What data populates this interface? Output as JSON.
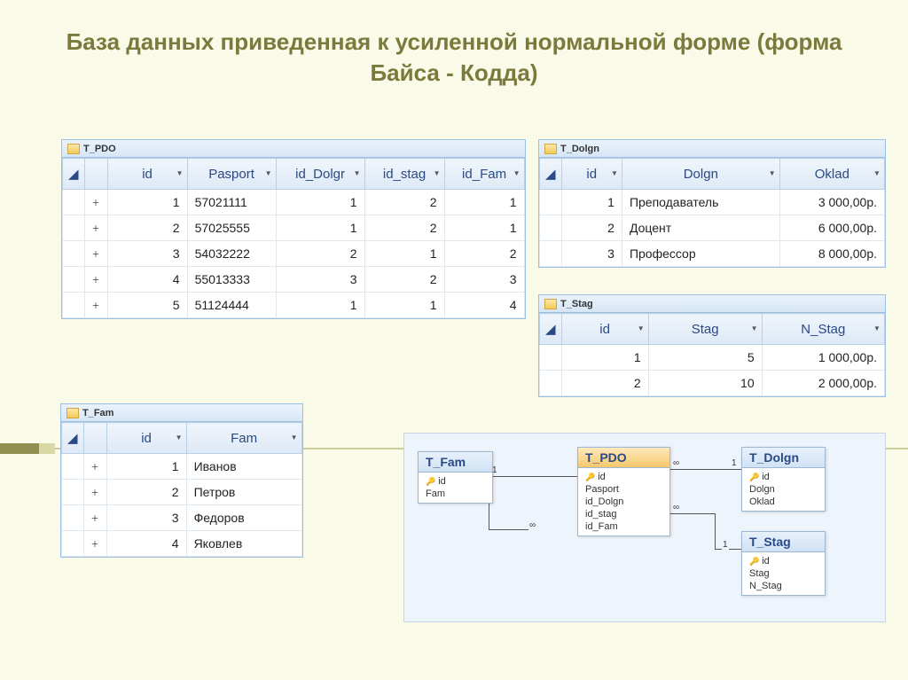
{
  "title": "База данных приведенная к усиленной нормальной форме  (форма Байса - Кодда)",
  "tables": {
    "pdo": {
      "tab": "T_PDO",
      "columns": [
        "id",
        "Pasport",
        "id_Dolgr",
        "id_stag",
        "id_Fam"
      ],
      "rows": [
        {
          "id": "1",
          "pasport": "57021111",
          "dolgn": "1",
          "stag": "2",
          "fam": "1"
        },
        {
          "id": "2",
          "pasport": "57025555",
          "dolgn": "1",
          "stag": "2",
          "fam": "1"
        },
        {
          "id": "3",
          "pasport": "54032222",
          "dolgn": "2",
          "stag": "1",
          "fam": "2"
        },
        {
          "id": "4",
          "pasport": "55013333",
          "dolgn": "3",
          "stag": "2",
          "fam": "3"
        },
        {
          "id": "5",
          "pasport": "51124444",
          "dolgn": "1",
          "stag": "1",
          "fam": "4"
        }
      ]
    },
    "dolgn": {
      "tab": "T_Dolgn",
      "columns": [
        "id",
        "Dolgn",
        "Oklad"
      ],
      "rows": [
        {
          "id": "1",
          "name": "Преподаватель",
          "oklad": "3 000,00р."
        },
        {
          "id": "2",
          "name": "Доцент",
          "oklad": "6 000,00р."
        },
        {
          "id": "3",
          "name": "Профессор",
          "oklad": "8 000,00р."
        }
      ]
    },
    "stag": {
      "tab": "T_Stag",
      "columns": [
        "id",
        "Stag",
        "N_Stag"
      ],
      "rows": [
        {
          "id": "1",
          "stag": "5",
          "nstag": "1 000,00р."
        },
        {
          "id": "2",
          "stag": "10",
          "nstag": "2 000,00р."
        }
      ]
    },
    "fam": {
      "tab": "T_Fam",
      "columns": [
        "id",
        "Fam"
      ],
      "rows": [
        {
          "id": "1",
          "fam": "Иванов"
        },
        {
          "id": "2",
          "fam": "Петров"
        },
        {
          "id": "3",
          "fam": "Федоров"
        },
        {
          "id": "4",
          "fam": "Яковлев"
        }
      ]
    }
  },
  "diagram": {
    "entities": {
      "fam": {
        "title": "T_Fam",
        "fields": [
          "id",
          "Fam"
        ],
        "pk": [
          0
        ]
      },
      "pdo": {
        "title": "T_PDO",
        "fields": [
          "id",
          "Pasport",
          "id_Dolgn",
          "id_stag",
          "id_Fam"
        ],
        "pk": [
          0
        ]
      },
      "dolgn": {
        "title": "T_Dolgn",
        "fields": [
          "id",
          "Dolgn",
          "Oklad"
        ],
        "pk": [
          0
        ]
      },
      "stag": {
        "title": "T_Stag",
        "fields": [
          "id",
          "Stag",
          "N_Stag"
        ],
        "pk": [
          0
        ]
      }
    },
    "labels": {
      "one": "1",
      "many": "∞"
    }
  }
}
